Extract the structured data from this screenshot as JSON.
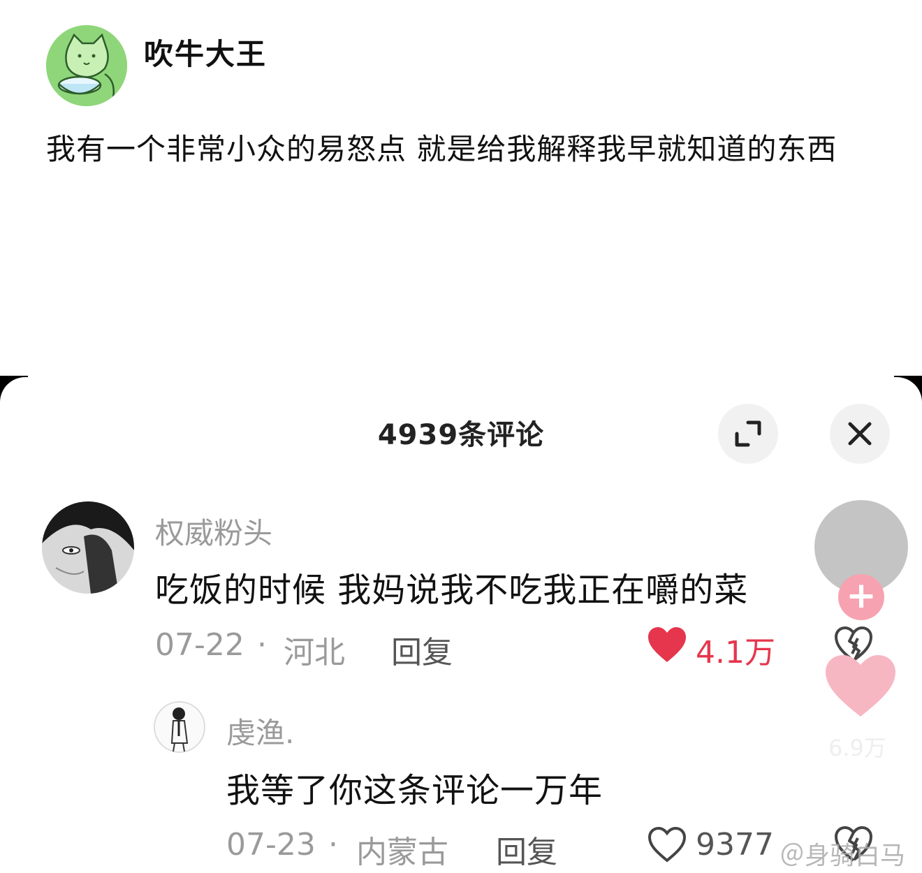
{
  "post": {
    "author": "吹牛大王",
    "text": "我有一个非常小众的易怒点 就是给我解释我早就知道的东西"
  },
  "comments_panel": {
    "title": "4939条评论",
    "expand_icon": "expand-icon",
    "close_icon": "close-icon"
  },
  "comments": [
    {
      "username": "权威粉头",
      "text": "吃饭的时候 我妈说我不吃我正在嚼的菜",
      "date": "07-22",
      "separator": "·",
      "location": "河北",
      "reply_label": "回复",
      "likes": "4.1万",
      "liked": true
    },
    {
      "username": "虔渔.",
      "text": "我等了你这条评论一万年",
      "date": "07-23",
      "separator": "·",
      "location": "内蒙古",
      "reply_label": "回复",
      "likes": "9377",
      "liked": false
    }
  ],
  "floating_controls": {
    "plus": "+",
    "like_count": "6.9万"
  },
  "watermark": "＠身骑白马",
  "colors": {
    "liked_red": "#e5364d",
    "avatar_green": "#8fd67a",
    "muted_gray": "#9a9a9a"
  }
}
